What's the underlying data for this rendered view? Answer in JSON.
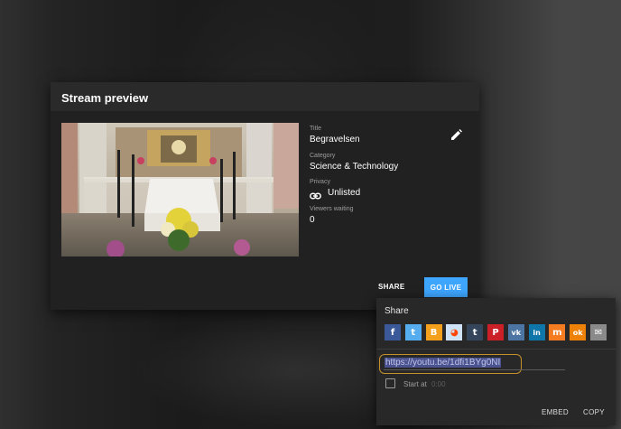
{
  "dialog": {
    "title": "Stream preview",
    "title_label": "Title",
    "title_value": "Begravelsen",
    "category_label": "Category",
    "category_value": "Science & Technology",
    "privacy_label": "Privacy",
    "privacy_value": "Unlisted",
    "viewers_label": "Viewers waiting",
    "viewers_value": "0",
    "share_label": "SHARE",
    "golive_label": "GO LIVE",
    "golive_color": "#3ea6ff"
  },
  "share_popup": {
    "title": "Share",
    "social": [
      {
        "name": "facebook-icon",
        "glyph": "f",
        "color": "#3b5998"
      },
      {
        "name": "twitter-icon",
        "glyph": "t",
        "color": "#55acee"
      },
      {
        "name": "blogger-icon",
        "glyph": "B",
        "color": "#f4a01c"
      },
      {
        "name": "reddit-icon",
        "glyph": "◕",
        "color": "#cee3f8"
      },
      {
        "name": "tumblr-icon",
        "glyph": "t",
        "color": "#35465c"
      },
      {
        "name": "pinterest-icon",
        "glyph": "P",
        "color": "#cb2027"
      },
      {
        "name": "vk-icon",
        "glyph": "vk",
        "color": "#4c75a3"
      },
      {
        "name": "linkedin-icon",
        "glyph": "in",
        "color": "#0e76a8"
      },
      {
        "name": "mix-icon",
        "glyph": "m",
        "color": "#f57c21"
      },
      {
        "name": "odnoklassniki-icon",
        "glyph": "ok",
        "color": "#ee8208"
      },
      {
        "name": "email-icon",
        "glyph": "✉",
        "color": "#8a8a8a"
      }
    ],
    "url": "https://youtu.be/1dfi1BYg0NI",
    "start_at_label": "Start at",
    "start_at_time": "0:00",
    "embed_label": "EMBED",
    "copy_label": "COPY",
    "highlight_color": "#c4902a"
  }
}
